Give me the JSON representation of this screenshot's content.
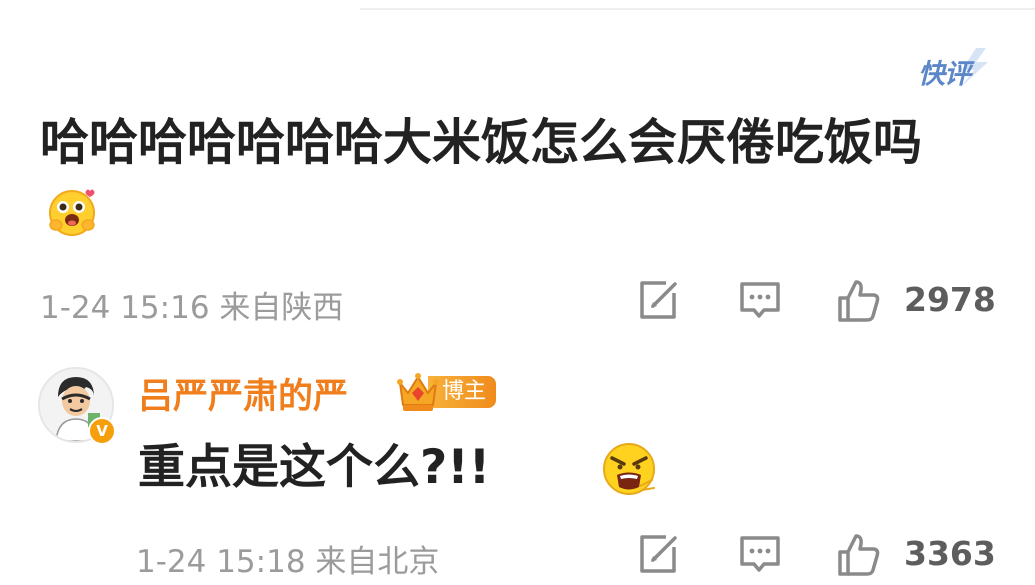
{
  "quick_review": {
    "label": "快评"
  },
  "comment": {
    "text": "哈哈哈哈哈哈哈大米饭怎么会厌倦吃饭吗",
    "emoji": "laughing-face-emoji",
    "time": "1-24 15:16",
    "location": "来自陕西",
    "likes": "2978",
    "icons": [
      "share-edit-icon",
      "comment-icon",
      "thumbs-up-icon"
    ]
  },
  "reply": {
    "author": "吕严严肃的严",
    "badge": "博主",
    "verified_badge": "V",
    "text": "重点是这个么?!!",
    "emoji": "angry-face-emoji",
    "time": "1-24 15:18",
    "location": "来自北京",
    "likes": "3363",
    "icons": [
      "share-edit-icon",
      "comment-icon",
      "thumbs-up-icon"
    ]
  },
  "colors": {
    "author": "#f07e1c",
    "quick_review": "#5b87c8",
    "meta": "#9b9b9b",
    "like_count": "#5d5d5d"
  }
}
